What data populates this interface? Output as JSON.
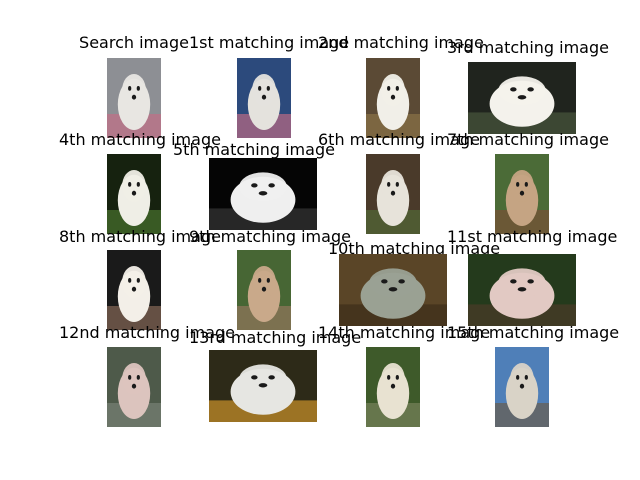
{
  "grid": [
    {
      "title": "Search image",
      "icon": "dog-gray-fluffy-icon",
      "bg": "#8d8f94",
      "fg": "#e8e6e2",
      "accent": "#c66b84"
    },
    {
      "title": "1st matching image",
      "icon": "dog-gray-fluffy-icon",
      "bg": "#2c4a7c",
      "fg": "#e4e2dd",
      "accent": "#c66b84"
    },
    {
      "title": "2nd matching image",
      "icon": "dog-white-on-straw-icon",
      "bg": "#5b4a35",
      "fg": "#f1efe8",
      "accent": "#8f7448"
    },
    {
      "title": "3rd matching image",
      "icon": "dog-white-poodle-icon",
      "bg": "#20241e",
      "fg": "#f4f2ec",
      "accent": "#4c5b3f"
    },
    {
      "title": "4th matching image",
      "icon": "dog-pair-on-grass-icon",
      "bg": "#16220f",
      "fg": "#efeee6",
      "accent": "#4d7a2f"
    },
    {
      "title": "5th matching image",
      "icon": "monkey-black-white-icon",
      "bg": "#050505",
      "fg": "#efefef",
      "accent": "#3a3a3a"
    },
    {
      "title": "6th matching image",
      "icon": "dogs-in-forest-icon",
      "bg": "#4a3a2a",
      "fg": "#e7e3da",
      "accent": "#526b38"
    },
    {
      "title": "7th matching image",
      "icon": "dog-long-hair-icon",
      "bg": "#4b6b37",
      "fg": "#c5a483",
      "accent": "#7c4e35"
    },
    {
      "title": "8th matching image",
      "icon": "dog-white-curly-icon",
      "bg": "#1a1a1a",
      "fg": "#f3efe8",
      "accent": "#8e6d5a"
    },
    {
      "title": "9th matching image",
      "icon": "dog-afghan-icon",
      "bg": "#476634",
      "fg": "#c9a98a",
      "accent": "#9a7860"
    },
    {
      "title": "10th matching image",
      "icon": "elephant-wood-icon",
      "bg": "#5a4527",
      "fg": "#9aa193",
      "accent": "#3a2b18"
    },
    {
      "title": "11st matching image",
      "icon": "dog-crested-icon",
      "bg": "#243a1c",
      "fg": "#e2c9c3",
      "accent": "#4e3a2a"
    },
    {
      "title": "12nd matching image",
      "icon": "dog-bulldog-icon",
      "bg": "#4e5a4a",
      "fg": "#dcc4be",
      "accent": "#7b8478"
    },
    {
      "title": "13rd matching image",
      "icon": "dog-crested-flowers-icon",
      "bg": "#2d2a18",
      "fg": "#e6e6e2",
      "accent": "#d89b2b"
    },
    {
      "title": "14th matching image",
      "icon": "dog-terrier-icon",
      "bg": "#3e5a2a",
      "fg": "#e8e2d1",
      "accent": "#7d8660"
    },
    {
      "title": "15th matching image",
      "icon": "dog-bearded-collie-icon",
      "bg": "#4f7fb8",
      "fg": "#d9d3c7",
      "accent": "#6b5a45"
    }
  ]
}
